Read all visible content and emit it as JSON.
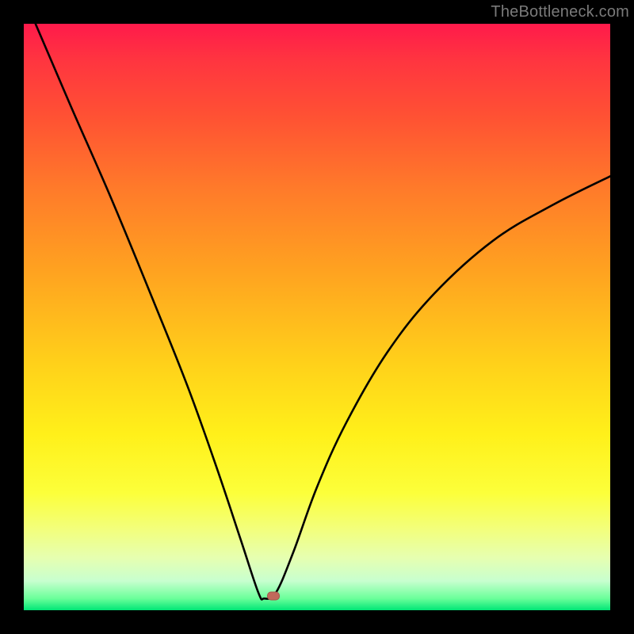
{
  "watermark": "TheBottleneck.com",
  "chart_data": {
    "type": "line",
    "title": "",
    "xlabel": "",
    "ylabel": "",
    "xlim": [
      0,
      100
    ],
    "ylim": [
      0,
      100
    ],
    "grid": false,
    "legend": false,
    "curve": {
      "minimum_x": 41,
      "minimum_y": 2,
      "left_start": {
        "x": 2,
        "y": 100
      },
      "right_end": {
        "x": 100,
        "y": 74
      },
      "points": [
        {
          "x": 2,
          "y": 100
        },
        {
          "x": 8,
          "y": 86
        },
        {
          "x": 15,
          "y": 70
        },
        {
          "x": 22,
          "y": 53
        },
        {
          "x": 28,
          "y": 38
        },
        {
          "x": 33,
          "y": 24
        },
        {
          "x": 37,
          "y": 12
        },
        {
          "x": 40,
          "y": 3
        },
        {
          "x": 41,
          "y": 2
        },
        {
          "x": 43,
          "y": 3
        },
        {
          "x": 46,
          "y": 10
        },
        {
          "x": 50,
          "y": 21
        },
        {
          "x": 55,
          "y": 32
        },
        {
          "x": 62,
          "y": 44
        },
        {
          "x": 70,
          "y": 54
        },
        {
          "x": 80,
          "y": 63
        },
        {
          "x": 90,
          "y": 69
        },
        {
          "x": 100,
          "y": 74
        }
      ]
    },
    "marker": {
      "x": 42.5,
      "y": 2.4
    },
    "gradient_stops": [
      {
        "pos": 0,
        "color": "#ff1a4b"
      },
      {
        "pos": 50,
        "color": "#ffd11a"
      },
      {
        "pos": 100,
        "color": "#00e676"
      }
    ]
  }
}
